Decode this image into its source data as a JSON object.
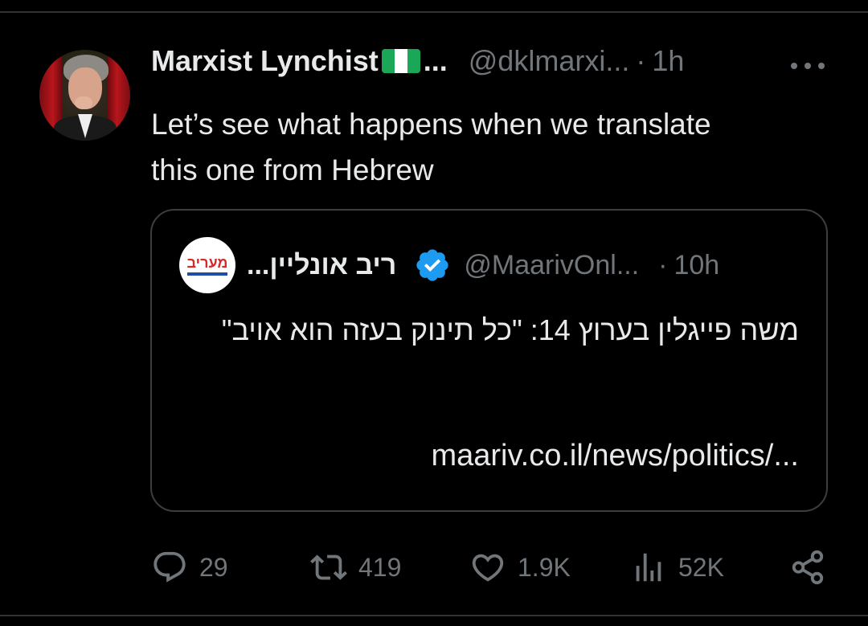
{
  "tweet": {
    "author": {
      "name": "Marxist Lynchist",
      "ellipsis": "...",
      "handle": "@dklmarxi...",
      "separator": "·",
      "time": "1h"
    },
    "text_lines": [
      "Let’s see what happens when we translate",
      "this one from Hebrew"
    ],
    "quote": {
      "author": {
        "name": "...ריב אונליין",
        "handle": "@MaarivOnl...",
        "separator": "·",
        "time": "10h",
        "avatar_logo": "מעריב"
      },
      "text": "משה פייגלין בערוץ 14: \"כל תינוק בעזה הוא אויב\"",
      "link": "maariv.co.il/news/politics/..."
    },
    "actions": {
      "replies": "29",
      "reposts": "419",
      "likes": "1.9K",
      "views": "52K"
    }
  },
  "icons": [
    "reply-icon",
    "repost-icon",
    "like-icon",
    "views-icon",
    "share-icon",
    "more-icon",
    "verified-icon",
    "nigeria-flag-emoji"
  ],
  "colors": {
    "background": "#000000",
    "text": "#e7e9ea",
    "muted": "#71767b",
    "border": "#2f3336",
    "verified": "#1d9bf0"
  }
}
